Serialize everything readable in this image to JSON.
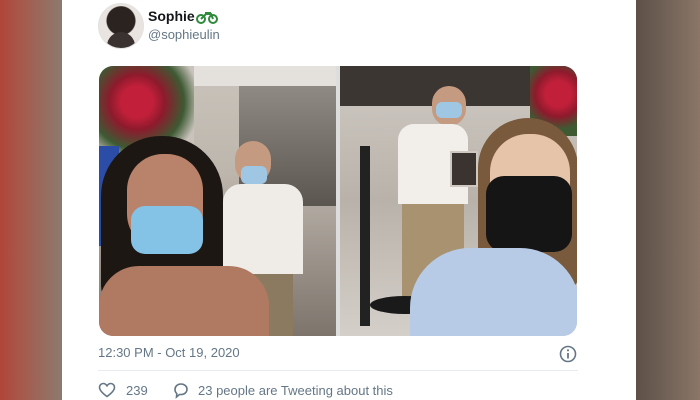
{
  "tweet": {
    "author_name": "Sophie",
    "author_handle": "@sophieulin",
    "timestamp": "12:30 PM - Oct 19, 2020",
    "like_count": "239",
    "tweeting_text": "23 people are Tweeting about this"
  },
  "icons": {
    "name_emoji": "motorcycle-emoji",
    "info": "info-icon",
    "like": "heart-icon",
    "reply": "speech-bubble-icon"
  },
  "colors": {
    "name_text": "#14171a",
    "secondary_text": "#657786",
    "emoji_green": "#2f8a3c"
  }
}
